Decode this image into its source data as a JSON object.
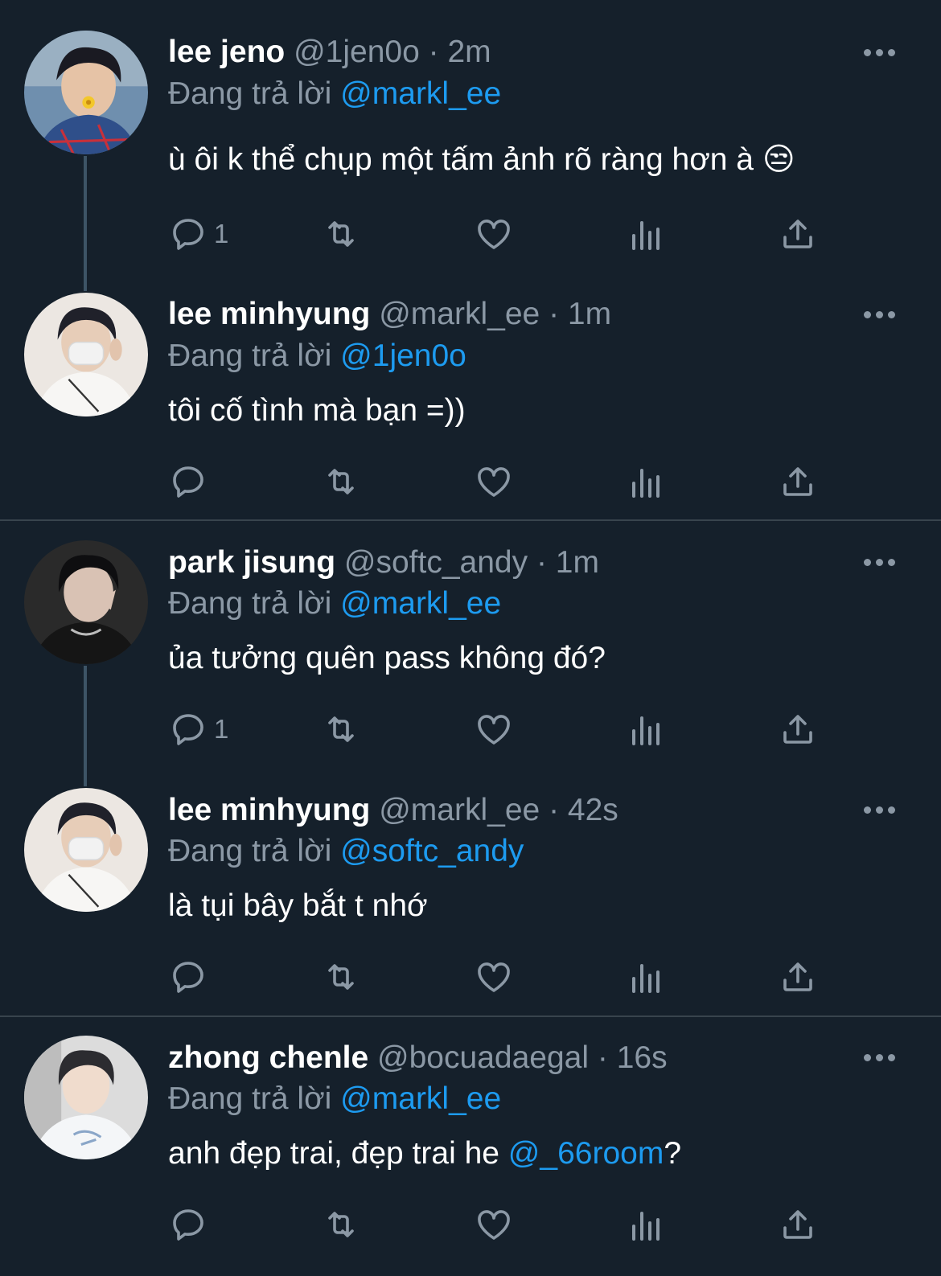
{
  "tweets": [
    {
      "name": "lee jeno",
      "handle": "@1jen0o",
      "time": "2m",
      "reply_prefix": "Đang trả lời",
      "reply_to": "@markl_ee",
      "text": "ù ôi k thể chụp một tấm ảnh rõ ràng hơn à 😒",
      "reply_count": "1",
      "avatar_icon": "avatar-photo"
    },
    {
      "name": "lee minhyung",
      "handle": "@markl_ee",
      "time": "1m",
      "reply_prefix": "Đang trả lời",
      "reply_to": "@1jen0o",
      "text": "tôi cố tình mà bạn =))",
      "reply_count": "",
      "avatar_icon": "avatar-photo"
    },
    {
      "name": "park jisung",
      "handle": "@softc_andy",
      "time": "1m",
      "reply_prefix": "Đang trả lời",
      "reply_to": "@markl_ee",
      "text": "ủa tưởng quên pass không đó?",
      "reply_count": "1",
      "avatar_icon": "avatar-photo"
    },
    {
      "name": "lee minhyung",
      "handle": "@markl_ee",
      "time": "42s",
      "reply_prefix": "Đang trả lời",
      "reply_to": "@softc_andy",
      "text": "là tụi bây bắt t nhớ",
      "reply_count": "",
      "avatar_icon": "avatar-photo"
    },
    {
      "name": "zhong chenle",
      "handle": "@bocuadaegal",
      "time": "16s",
      "reply_prefix": "Đang trả lời",
      "reply_to": "@markl_ee",
      "text_before": "anh đẹp trai, đẹp trai he ",
      "text_mention": "@_66room",
      "text_after": "?",
      "reply_count": "",
      "avatar_icon": "avatar-photo"
    }
  ],
  "dot_separator": "·",
  "action_icons": [
    "reply-icon",
    "retweet-icon",
    "like-icon",
    "views-icon",
    "share-icon"
  ],
  "colors": {
    "background": "#15202b",
    "mention": "#1d9bf0",
    "secondary": "#8b98a5",
    "thread_line": "#3d5466"
  }
}
